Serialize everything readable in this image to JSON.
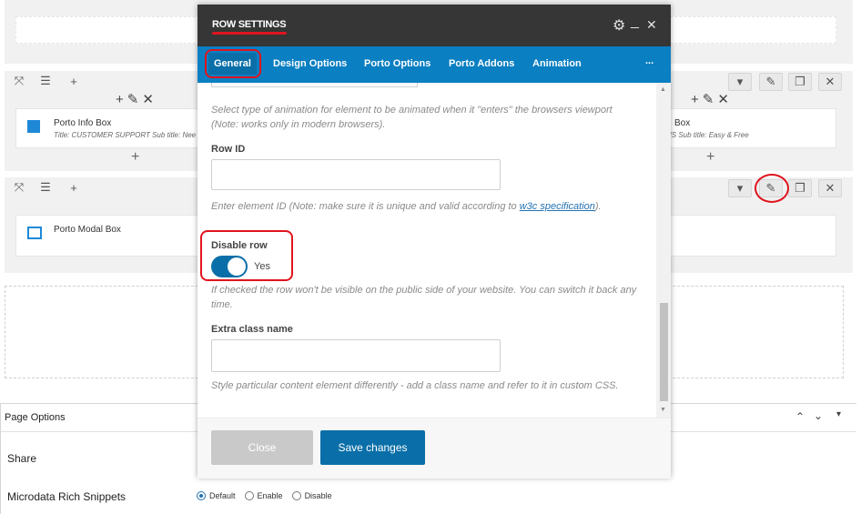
{
  "background": {
    "row2_elements": {
      "info_box_title": "Porto Info Box",
      "info_box_sub": "Title: CUSTOMER SUPPORT  Sub title: Nee",
      "right_box_title": "Box",
      "right_box_sub": "NS  Sub title: Easy & Free"
    },
    "row3_elements": {
      "modal_box_title": "Porto Modal Box"
    }
  },
  "modal": {
    "title": "ROW SETTINGS",
    "tabs": [
      {
        "label": "General"
      },
      {
        "label": "Design Options"
      },
      {
        "label": "Porto Options"
      },
      {
        "label": "Porto Addons"
      },
      {
        "label": "Animation"
      },
      {
        "label": "..."
      }
    ],
    "help_animation": "Select type of animation for element to be animated when it \"enters\" the browsers viewport (Note: works only in modern browsers).",
    "row_id_label": "Row ID",
    "help_row_id_prefix": "Enter element ID (Note: make sure it is unique and valid according to ",
    "help_row_id_link": "w3c specification",
    "help_row_id_suffix": ").",
    "disable_row_label": "Disable row",
    "disable_row_value": "Yes",
    "help_disable": "If checked the row won't be visible on the public side of your website. You can switch it back any time.",
    "extra_class_label": "Extra class name",
    "help_extra_class": "Style particular content element differently - add a class name and refer to it in custom CSS.",
    "close_label": "Close",
    "save_label": "Save changes"
  },
  "page_options": {
    "title": "Page Options",
    "share_label": "Share",
    "microdata_label": "Microdata Rich Snippets",
    "microdata_options": [
      {
        "label": "Default",
        "selected": true
      },
      {
        "label": "Enable",
        "selected": false
      },
      {
        "label": "Disable",
        "selected": false
      }
    ]
  },
  "colors": {
    "accent": "#0a7fc2",
    "header": "#363636",
    "annotation": "#e0141e"
  }
}
